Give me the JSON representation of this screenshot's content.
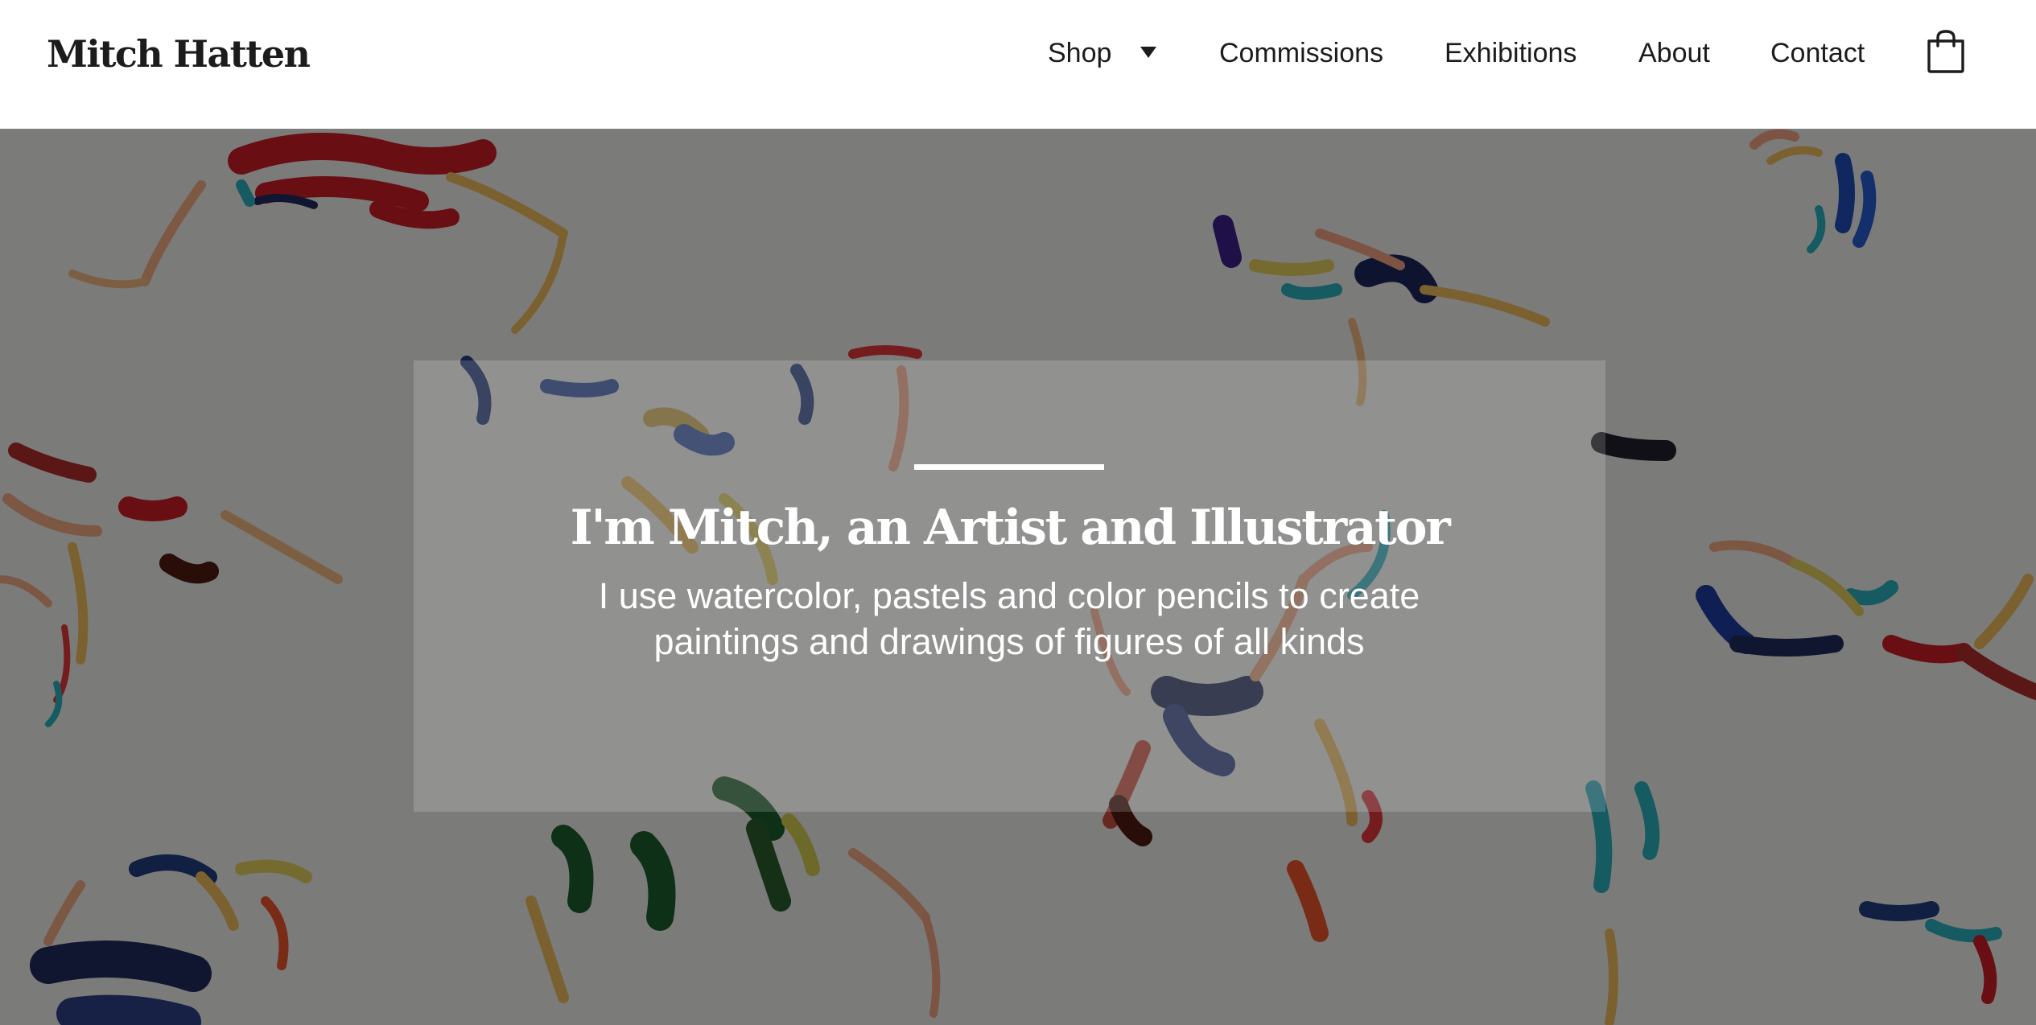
{
  "header": {
    "brand": "Mitch Hatten",
    "nav": {
      "shop": "Shop",
      "commissions": "Commissions",
      "exhibitions": "Exhibitions",
      "about": "About",
      "contact": "Contact"
    },
    "cart_icon": "shopping-bag-icon",
    "dropdown_icon": "caret-down-icon"
  },
  "hero": {
    "title": "I'm Mitch, an Artist and Illustrator",
    "subtitle_line1": "I use watercolor, pastels and color pencils to create",
    "subtitle_line2": "paintings and drawings of figures of all kinds"
  },
  "colors": {
    "text_dark": "#1c1c1c",
    "header_bg": "#ffffff",
    "hero_text": "#ffffff"
  }
}
